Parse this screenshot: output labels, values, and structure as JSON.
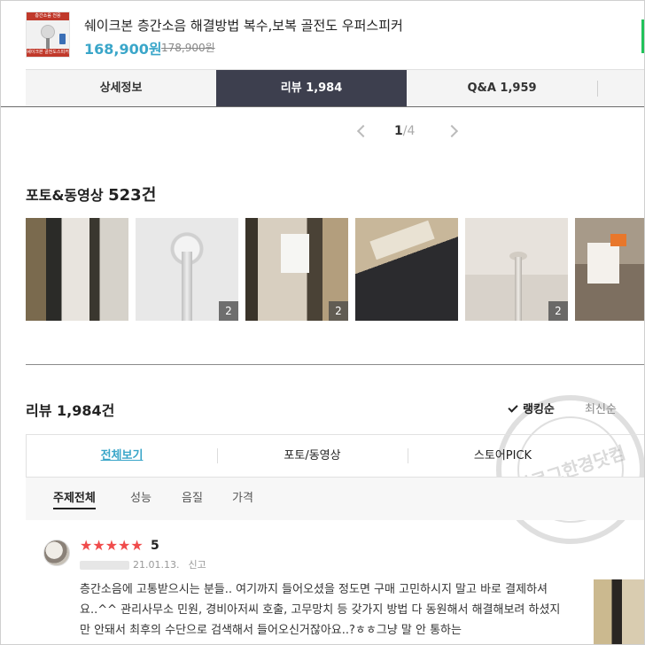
{
  "product": {
    "title": "쉐이크본 층간소음 해결방법 복수,보복 골전도 우퍼스피커",
    "price": "168,900원",
    "original_price": "178,900원",
    "thumb_top_text": "층간소음 전용",
    "thumb_bottom_text": "쉐이크본 골전도스피커"
  },
  "tabs": [
    {
      "label": "상세정보"
    },
    {
      "label": "리뷰 1,984"
    },
    {
      "label": "Q&A 1,959"
    }
  ],
  "pager": {
    "current": "1",
    "total": "/4"
  },
  "photo_section": {
    "title": "포토&동영상 ",
    "count": "523건",
    "badges": [
      "2",
      "2",
      "2"
    ]
  },
  "reviews": {
    "title": "리뷰 1,984건",
    "sort_ranking": "랭킹순",
    "sort_latest": "최신순",
    "filters": [
      "전체보기",
      "포토/동영상",
      "스토어PICK"
    ],
    "topics": [
      "주제전체",
      "성능",
      "음질",
      "가격"
    ]
  },
  "review_item": {
    "stars": "★★★★★",
    "score": "5",
    "date": "21.01.13.",
    "report": "신고",
    "body": "층간소음에 고통받으시는 분들.. 여기까지 들어오셨을 정도면 구매 고민하시지 말고 바로 결제하셔요..^^ 관리사무소 민원, 경비아저씨 호출, 고무망치 등 갖가지 방법 다 동원해서 해결해보려 하셨지만 안돼서 최후의 수단으로 검색해서 들어오신거잖아요..?ㅎㅎ그냥 말 안 통하는"
  },
  "watermark": {
    "text": "블로그한경닷컴"
  },
  "colors": {
    "accent": "#3aa6c9",
    "active_tab": "#3d3f4e",
    "star": "#f04b4b"
  }
}
